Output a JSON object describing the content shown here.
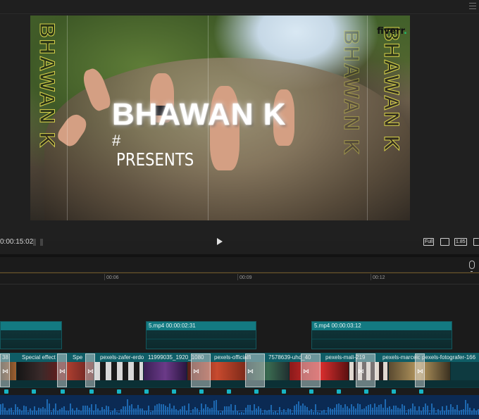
{
  "preview": {
    "title_text": "BHAWAN K",
    "hash_text": "#",
    "presents_text": "PRESENTS",
    "side_text_left": "BHAWAN K",
    "side_text_right": "BHAWAN K",
    "brand_text": "fiverr",
    "brand_dot": ".",
    "timecode": "0:00:15:02",
    "full_label": "Full",
    "ratio_label": "1.85"
  },
  "timeline": {
    "ruler_ticks": [
      "00:06",
      "00:09",
      "00:12"
    ],
    "upper_clips": [
      {
        "label": ""
      },
      {
        "label": "5.mp4  00:00:02:31"
      },
      {
        "label": "5.mp4  00:00:03:12"
      }
    ],
    "main_clips": [
      {
        "label": "38"
      },
      {
        "label": "Special effect"
      },
      {
        "label": "Spe"
      },
      {
        "label": "pexels-zafer-erdo"
      },
      {
        "label": "11999035_1920_1080"
      },
      {
        "label": "pexels-officialfi"
      },
      {
        "label": "7578639-uhd_40"
      },
      {
        "label": "pexels-mali-219"
      },
      {
        "label": "pexels-marcelo"
      },
      {
        "label": "pexels-fotografer-166"
      }
    ]
  },
  "colors": {
    "clip_header": "#137a82",
    "track_bg": "#0e3a40",
    "audio_bg": "#0b2a53",
    "marker": "#17b4c4",
    "title_stroke": "#d8d24a"
  }
}
